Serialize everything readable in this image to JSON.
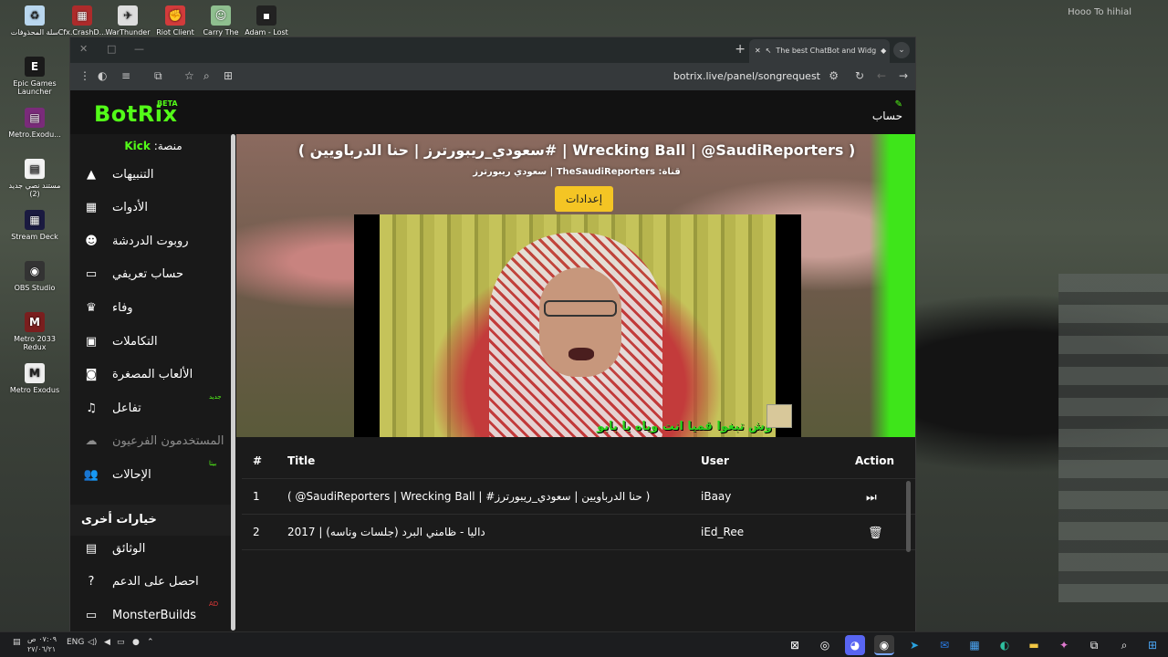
{
  "desktop": {
    "top_right_text": "Hooo To hihial",
    "icons": [
      {
        "label": "سلة المحذوفات",
        "icon": "recycle-bin-icon",
        "color": "#b9d7ef",
        "glyph": "♻"
      },
      {
        "label": "Cfx.CrashD...",
        "icon": "cfx-icon",
        "color": "#ad2b2b",
        "glyph": "▦"
      },
      {
        "label": "WarThunder",
        "icon": "warthunder-icon",
        "color": "#dddddd",
        "glyph": "✈"
      },
      {
        "label": "Riot Client",
        "icon": "riot-icon",
        "color": "#d23b3b",
        "glyph": "✊"
      },
      {
        "label": "Carry The",
        "icon": "carry-icon",
        "color": "#8fbf8f",
        "glyph": "☺"
      },
      {
        "label": "Adam - Lost",
        "icon": "adam-icon",
        "color": "#222222",
        "glyph": "▪"
      },
      {
        "label": "Epic Games Launcher",
        "icon": "epic-icon",
        "color": "#1a1a1a",
        "glyph": "E"
      },
      {
        "label": "Metro.Exodu...",
        "icon": "metro-winrar-icon",
        "color": "#7a2b7a",
        "glyph": "▤"
      },
      {
        "label": "مستند نصي جديد (2)",
        "icon": "text-document-icon",
        "color": "#f2f2f2",
        "glyph": "▤"
      },
      {
        "label": "Stream Deck",
        "icon": "streamdeck-icon",
        "color": "#1a1a40",
        "glyph": "▦"
      },
      {
        "label": "OBS Studio",
        "icon": "obs-icon",
        "color": "#333333",
        "glyph": "◉"
      },
      {
        "label": "Metro 2033 Redux",
        "icon": "metro2033-icon",
        "color": "#7a1e1e",
        "glyph": "M"
      },
      {
        "label": "Metro Exodus",
        "icon": "metro-exodus-icon",
        "color": "#eeeeee",
        "glyph": "M"
      }
    ]
  },
  "browser": {
    "tab_title": "The best ChatBot and Widg",
    "new_tab": "+",
    "url": "botrix.live/panel/songrequest"
  },
  "app": {
    "logo": "BotRix",
    "beta": "BETA",
    "account": "حساب",
    "platform_label": "منصة:",
    "platform_name": "Kick",
    "nav": [
      {
        "label": "التنبيهات",
        "icon": "warning-icon",
        "glyph": "▲",
        "badge": ""
      },
      {
        "label": "الأدوات",
        "icon": "grid-icon",
        "glyph": "▦",
        "badge": ""
      },
      {
        "label": "روبوت الدردشة",
        "icon": "robot-icon",
        "glyph": "☻",
        "badge": ""
      },
      {
        "label": "حساب تعريفي",
        "icon": "id-card-icon",
        "glyph": "▭",
        "badge": ""
      },
      {
        "label": "وفاء",
        "icon": "trophy-icon",
        "glyph": "♛",
        "badge": ""
      },
      {
        "label": "التكاملات",
        "icon": "integration-icon",
        "glyph": "▣",
        "badge": ""
      },
      {
        "label": "الألعاب المصغرة",
        "icon": "gamepad-icon",
        "glyph": "◙",
        "badge": ""
      },
      {
        "label": "تفاعل",
        "icon": "music-icon",
        "glyph": "♫",
        "badge": "جديد"
      },
      {
        "label": "المستخدمون الفرعيون",
        "icon": "cloud-icon",
        "glyph": "☁",
        "badge": "",
        "disabled": true
      },
      {
        "label": "الإحالات",
        "icon": "users-icon",
        "glyph": "👥",
        "badge": "بيتا"
      }
    ],
    "other_options_title": "خيارات أخرى",
    "other": [
      {
        "label": "الوثائق",
        "icon": "docs-icon",
        "glyph": "▤",
        "badge": ""
      },
      {
        "label": "احصل على الدعم",
        "icon": "help-icon",
        "glyph": "?",
        "badge": ""
      },
      {
        "label": "MonsterBuilds",
        "icon": "monitor-icon",
        "glyph": "▭",
        "badge": "AD"
      }
    ]
  },
  "player": {
    "song_title": "( سعودي_ريبورترز | حنا الدرباويين# | Wrecking Ball | @SaudiReporters )",
    "song_sub": "سعودي ريبورترز | TheSaudiReporters :قناة",
    "settings_button": "إعدادات",
    "video_subtitle": "وش تبغوا قميا انت وياه يا بابو"
  },
  "queue": {
    "headers": {
      "num": "#",
      "title": "Title",
      "user": "User",
      "action": "Action"
    },
    "rows": [
      {
        "num": "1",
        "title": "( @SaudiReporters | Wrecking Ball | #حنا الدرباويين | سعودي_ريبورترز )",
        "user": "iBaay",
        "action_icon": "skip-forward-icon",
        "action_glyph": "⏭"
      },
      {
        "num": "2",
        "title": "داليا - ظامني البرد (جلسات وناسه) | 2017",
        "user": "iEd_Ree",
        "action_icon": "trash-icon",
        "action_glyph": "🗑"
      }
    ]
  },
  "taskbar": {
    "time": "٠٧:٠٩ ص",
    "date": "٢٧/٠٦/٢١",
    "lang": "ENG"
  }
}
